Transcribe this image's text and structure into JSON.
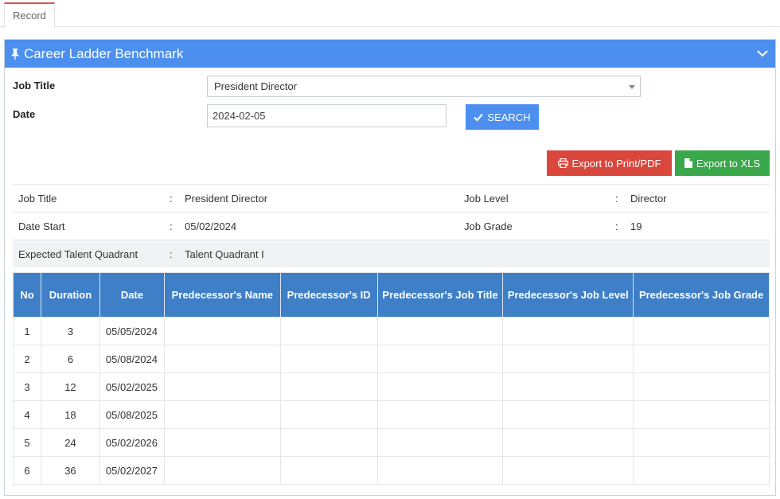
{
  "tabs": [
    {
      "label": "Record"
    }
  ],
  "panel": {
    "title": "Career Ladder Benchmark"
  },
  "form": {
    "job_title_label": "Job Title",
    "job_title_value": "President Director",
    "date_label": "Date",
    "date_value": "2024-02-05",
    "search_label": "SEARCH"
  },
  "actions": {
    "export_pdf_label": "Export to Print/PDF",
    "export_xls_label": "Export to XLS"
  },
  "info": {
    "separator": ":",
    "job_title_label": "Job Title",
    "job_title_value": "President Director",
    "job_level_label": "Job Level",
    "job_level_value": "Director",
    "date_start_label": "Date Start",
    "date_start_value": "05/02/2024",
    "job_grade_label": "Job Grade",
    "job_grade_value": "19",
    "talent_label": "Expected Talent Quadrant",
    "talent_value": "Talent Quadrant I"
  },
  "table": {
    "headers": [
      "No",
      "Duration",
      "Date",
      "Predecessor's Name",
      "Predecessor's ID",
      "Predecessor's Job Title",
      "Predecessor's Job Level",
      "Predecessor's Job Grade"
    ],
    "rows": [
      [
        "1",
        "3",
        "05/05/2024",
        "",
        "",
        "",
        "",
        ""
      ],
      [
        "2",
        "6",
        "05/08/2024",
        "",
        "",
        "",
        "",
        ""
      ],
      [
        "3",
        "12",
        "05/02/2025",
        "",
        "",
        "",
        "",
        ""
      ],
      [
        "4",
        "18",
        "05/08/2025",
        "",
        "",
        "",
        "",
        ""
      ],
      [
        "5",
        "24",
        "05/02/2026",
        "",
        "",
        "",
        "",
        ""
      ],
      [
        "6",
        "36",
        "05/02/2027",
        "",
        "",
        "",
        "",
        ""
      ]
    ]
  },
  "icons": {
    "pin": "pin-icon",
    "collapse": "chevron-down-icon",
    "search": "check-icon",
    "pdf": "printer-icon",
    "xls": "file-icon"
  },
  "colors": {
    "header_blue": "#4c8fef",
    "table_header": "#3f7fc7",
    "danger": "#d9473c",
    "success": "#3aa74a",
    "tab_accent": "#d9534f"
  }
}
